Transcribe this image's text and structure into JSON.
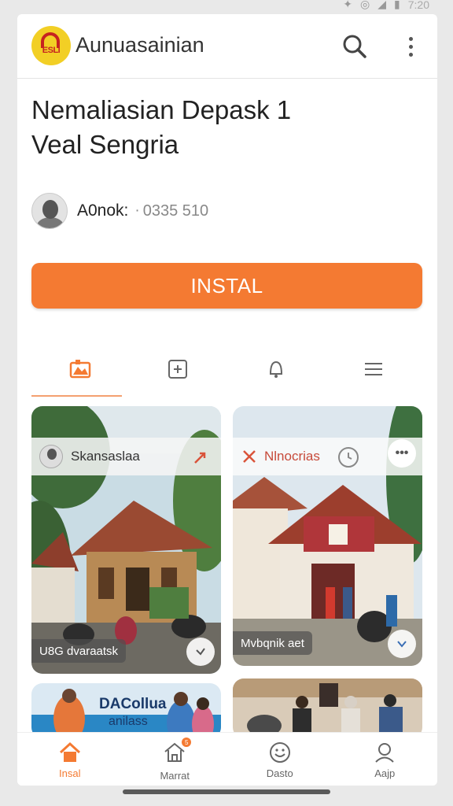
{
  "status_bar": {
    "clock": "7:20"
  },
  "app_bar": {
    "title": "Aunuasainian"
  },
  "headline": {
    "line1": "Nemaliasian Depask 1",
    "line2": "Veal Sengria"
  },
  "author": {
    "name": "A0nok:",
    "separator": "·",
    "count": "0335 510"
  },
  "install": {
    "label": "INSTAL"
  },
  "tabs": [
    {
      "icon": "house-image-icon",
      "active": true
    },
    {
      "icon": "puzzle-icon",
      "active": false
    },
    {
      "icon": "bell-icon",
      "active": false
    },
    {
      "icon": "menu-icon",
      "active": false
    }
  ],
  "cards": [
    {
      "header": "Skansaslaa",
      "footer": "U8G dvaraatsk"
    },
    {
      "header": "Nlnocrias",
      "footer": "Mvbqnik aet"
    },
    {
      "title": "DACollua",
      "subtitle": "anilass"
    },
    {}
  ],
  "bottom_nav": [
    {
      "label": "Insal",
      "icon": "home-icon",
      "active": true
    },
    {
      "label": "Marrat",
      "icon": "shop-icon",
      "badge": "5",
      "active": false
    },
    {
      "label": "Dasto",
      "icon": "smiley-icon",
      "active": false
    },
    {
      "label": "Aajp",
      "icon": "profile-icon",
      "active": false
    }
  ],
  "colors": {
    "accent": "#f47a32",
    "logo_bg": "#f2cf25",
    "logo_red": "#c62320"
  }
}
